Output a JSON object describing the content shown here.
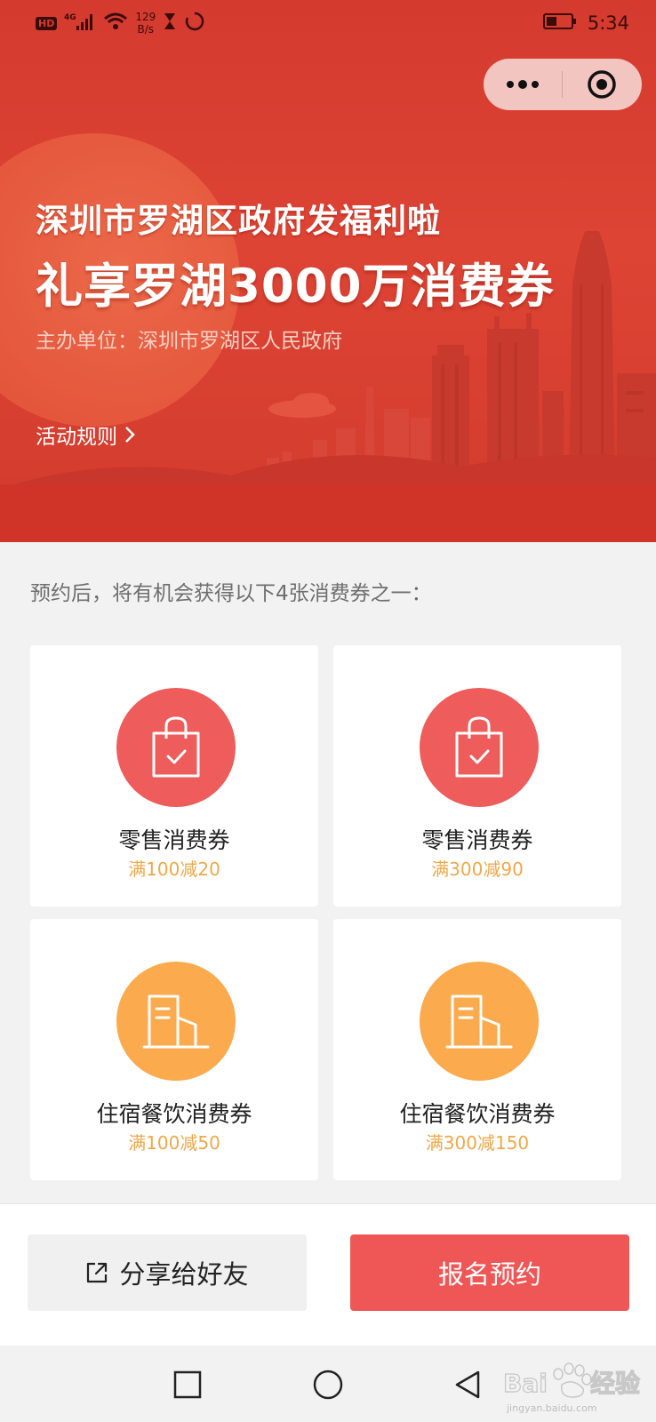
{
  "status_bar": {
    "hd": "HD",
    "network": "4G",
    "net_speed_value": "129",
    "net_speed_unit": "B/s",
    "time": "5:34"
  },
  "hero": {
    "subtitle": "深圳市罗湖区政府发福利啦",
    "title": "礼享罗湖3000万消费券",
    "organizer": "主办单位：深圳市罗湖区人民政府",
    "rules_link": "活动规则"
  },
  "intro_text": "预约后，将有机会获得以下4张消费券之一：",
  "coupons": [
    {
      "name": "零售消费券",
      "desc": "满100减20",
      "icon": "shopping-bag-icon"
    },
    {
      "name": "零售消费券",
      "desc": "满300减90",
      "icon": "shopping-bag-icon"
    },
    {
      "name": "住宿餐饮消费券",
      "desc": "满100减50",
      "icon": "building-icon"
    },
    {
      "name": "住宿餐饮消费券",
      "desc": "满300减150",
      "icon": "building-icon"
    }
  ],
  "actions": {
    "share_label": "分享给好友",
    "register_label": "报名预约"
  },
  "watermark": {
    "brand": "Baidu",
    "brand_cn": "经验",
    "url": "jingyan.baidu.com"
  },
  "colors": {
    "hero_red": "#d43a2e",
    "coupon_red": "#ee5c5c",
    "coupon_orange": "#fbaa4d",
    "coupon_desc": "#f0a84a",
    "primary_button": "#ef5757"
  }
}
